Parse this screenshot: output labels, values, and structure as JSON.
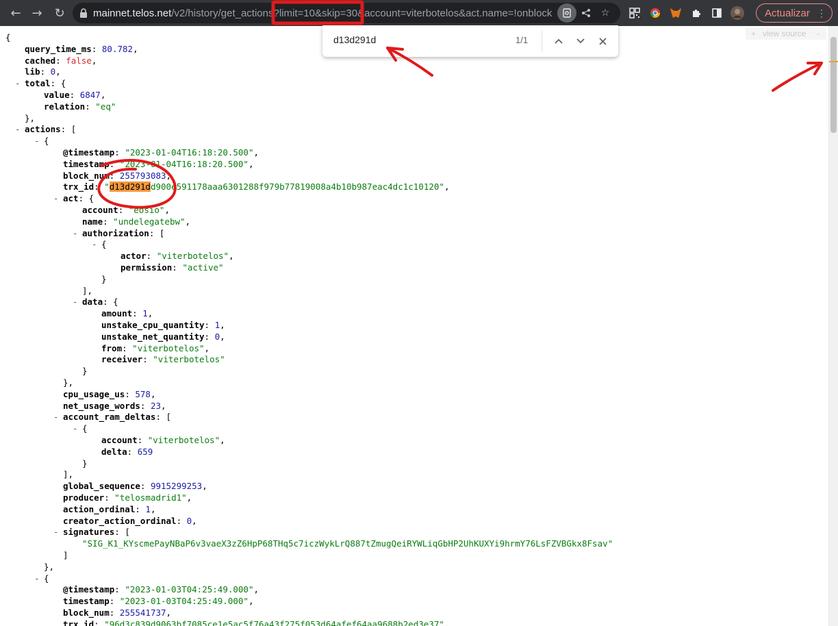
{
  "browser": {
    "url_host": "mainnet.telos.net",
    "url_path": "/v2/history/get_actions",
    "url_query": "?limit=10&skip=30&account=viterbotelos&act.name=!onblock",
    "update_label": "Actualizar",
    "view_source_label": "view source"
  },
  "find": {
    "query": "d13d291d",
    "count": "1/1"
  },
  "colors": {
    "annotation_red": "#e01b1b",
    "highlight": "#f5973a",
    "string": "#0b7c10",
    "number": "#1a1aa6",
    "boolean": "#d2282f"
  },
  "json_lines": [
    [
      {
        "t": "{"
      }
    ],
    [
      {
        "t": "query_time_ms",
        "c": "k"
      },
      {
        "t": ": "
      },
      {
        "t": "80.782",
        "c": "n"
      },
      {
        "t": ","
      }
    ],
    [
      {
        "t": "cached",
        "c": "k"
      },
      {
        "t": ": "
      },
      {
        "t": "false",
        "c": "b"
      },
      {
        "t": ","
      }
    ],
    [
      {
        "t": "lib",
        "c": "k"
      },
      {
        "t": ": "
      },
      {
        "t": "0",
        "c": "n"
      },
      {
        "t": ","
      }
    ],
    [
      {
        "t": "total",
        "c": "k"
      },
      {
        "t": ": {"
      }
    ],
    [
      {
        "t": "value",
        "c": "k"
      },
      {
        "t": ": "
      },
      {
        "t": "6847",
        "c": "n"
      },
      {
        "t": ","
      }
    ],
    [
      {
        "t": "relation",
        "c": "k"
      },
      {
        "t": ": "
      },
      {
        "t": "\"eq\"",
        "c": "s"
      }
    ],
    [
      {
        "t": "},"
      }
    ],
    [
      {
        "t": "actions",
        "c": "k"
      },
      {
        "t": ": ["
      }
    ],
    [
      {
        "t": "{"
      }
    ],
    [
      {
        "t": "@timestamp",
        "c": "k"
      },
      {
        "t": ": "
      },
      {
        "t": "\"2023-01-04T16:18:20.500\"",
        "c": "s"
      },
      {
        "t": ","
      }
    ],
    [
      {
        "t": "timestamp",
        "c": "k"
      },
      {
        "t": ": "
      },
      {
        "t": "\"2023-01-04T16:18:20.500\"",
        "c": "s"
      },
      {
        "t": ","
      }
    ],
    [
      {
        "t": "block_num",
        "c": "k"
      },
      {
        "t": ": "
      },
      {
        "t": "255793083",
        "c": "n"
      },
      {
        "t": ","
      }
    ],
    [
      {
        "t": "trx_id",
        "c": "k"
      },
      {
        "t": ": "
      },
      {
        "t": "\"",
        "c": "s"
      },
      {
        "t": "d13d291d",
        "c": "hl"
      },
      {
        "t": "d900e591178aaa6301288f979b77819008a4b10b987eac4dc1c10120\"",
        "c": "s"
      },
      {
        "t": ","
      }
    ],
    [
      {
        "t": "act",
        "c": "k"
      },
      {
        "t": ": {"
      }
    ],
    [
      {
        "t": "account",
        "c": "k"
      },
      {
        "t": ": "
      },
      {
        "t": "\"eosio\"",
        "c": "s"
      },
      {
        "t": ","
      }
    ],
    [
      {
        "t": "name",
        "c": "k"
      },
      {
        "t": ": "
      },
      {
        "t": "\"undelegatebw\"",
        "c": "s"
      },
      {
        "t": ","
      }
    ],
    [
      {
        "t": "authorization",
        "c": "k"
      },
      {
        "t": ": ["
      }
    ],
    [
      {
        "t": "{"
      }
    ],
    [
      {
        "t": "actor",
        "c": "k"
      },
      {
        "t": ": "
      },
      {
        "t": "\"viterbotelos\"",
        "c": "s"
      },
      {
        "t": ","
      }
    ],
    [
      {
        "t": "permission",
        "c": "k"
      },
      {
        "t": ": "
      },
      {
        "t": "\"active\"",
        "c": "s"
      }
    ],
    [
      {
        "t": "}"
      }
    ],
    [
      {
        "t": "],"
      }
    ],
    [
      {
        "t": "data",
        "c": "k"
      },
      {
        "t": ": {"
      }
    ],
    [
      {
        "t": "amount",
        "c": "k"
      },
      {
        "t": ": "
      },
      {
        "t": "1",
        "c": "n"
      },
      {
        "t": ","
      }
    ],
    [
      {
        "t": "unstake_cpu_quantity",
        "c": "k"
      },
      {
        "t": ": "
      },
      {
        "t": "1",
        "c": "n"
      },
      {
        "t": ","
      }
    ],
    [
      {
        "t": "unstake_net_quantity",
        "c": "k"
      },
      {
        "t": ": "
      },
      {
        "t": "0",
        "c": "n"
      },
      {
        "t": ","
      }
    ],
    [
      {
        "t": "from",
        "c": "k"
      },
      {
        "t": ": "
      },
      {
        "t": "\"viterbotelos\"",
        "c": "s"
      },
      {
        "t": ","
      }
    ],
    [
      {
        "t": "receiver",
        "c": "k"
      },
      {
        "t": ": "
      },
      {
        "t": "\"viterbotelos\"",
        "c": "s"
      }
    ],
    [
      {
        "t": "}"
      }
    ],
    [
      {
        "t": "},"
      }
    ],
    [
      {
        "t": "cpu_usage_us",
        "c": "k"
      },
      {
        "t": ": "
      },
      {
        "t": "578",
        "c": "n"
      },
      {
        "t": ","
      }
    ],
    [
      {
        "t": "net_usage_words",
        "c": "k"
      },
      {
        "t": ": "
      },
      {
        "t": "23",
        "c": "n"
      },
      {
        "t": ","
      }
    ],
    [
      {
        "t": "account_ram_deltas",
        "c": "k"
      },
      {
        "t": ": ["
      }
    ],
    [
      {
        "t": "{"
      }
    ],
    [
      {
        "t": "account",
        "c": "k"
      },
      {
        "t": ": "
      },
      {
        "t": "\"viterbotelos\"",
        "c": "s"
      },
      {
        "t": ","
      }
    ],
    [
      {
        "t": "delta",
        "c": "k"
      },
      {
        "t": ": "
      },
      {
        "t": "659",
        "c": "n"
      }
    ],
    [
      {
        "t": "}"
      }
    ],
    [
      {
        "t": "],"
      }
    ],
    [
      {
        "t": "global_sequence",
        "c": "k"
      },
      {
        "t": ": "
      },
      {
        "t": "9915299253",
        "c": "n"
      },
      {
        "t": ","
      }
    ],
    [
      {
        "t": "producer",
        "c": "k"
      },
      {
        "t": ": "
      },
      {
        "t": "\"telosmadrid1\"",
        "c": "s"
      },
      {
        "t": ","
      }
    ],
    [
      {
        "t": "action_ordinal",
        "c": "k"
      },
      {
        "t": ": "
      },
      {
        "t": "1",
        "c": "n"
      },
      {
        "t": ","
      }
    ],
    [
      {
        "t": "creator_action_ordinal",
        "c": "k"
      },
      {
        "t": ": "
      },
      {
        "t": "0",
        "c": "n"
      },
      {
        "t": ","
      }
    ],
    [
      {
        "t": "signatures",
        "c": "k"
      },
      {
        "t": ": ["
      }
    ],
    [
      {
        "t": "\"SIG_K1_KYscmePayNBaP6v3vaeX3zZ6HpP68THq5c7iczWykLrQ887tZmugQeiRYWLiqGbHP2UhKUXYi9hrmY76LsFZVBGkx8Fsav\"",
        "c": "s"
      }
    ],
    [
      {
        "t": "]"
      }
    ],
    [
      {
        "t": "},"
      }
    ],
    [
      {
        "t": "{"
      }
    ],
    [
      {
        "t": "@timestamp",
        "c": "k"
      },
      {
        "t": ": "
      },
      {
        "t": "\"2023-01-03T04:25:49.000\"",
        "c": "s"
      },
      {
        "t": ","
      }
    ],
    [
      {
        "t": "timestamp",
        "c": "k"
      },
      {
        "t": ": "
      },
      {
        "t": "\"2023-01-03T04:25:49.000\"",
        "c": "s"
      },
      {
        "t": ","
      }
    ],
    [
      {
        "t": "block_num",
        "c": "k"
      },
      {
        "t": ": "
      },
      {
        "t": "255541737",
        "c": "n"
      },
      {
        "t": ","
      }
    ],
    [
      {
        "t": "trx_id",
        "c": "k"
      },
      {
        "t": ": "
      },
      {
        "t": "\"96d3c839d9063bf7085ce1e5ac5f76a43f275f053d64afef64aa9688b2ed3e37\"",
        "c": "s"
      },
      {
        "t": ","
      }
    ]
  ]
}
